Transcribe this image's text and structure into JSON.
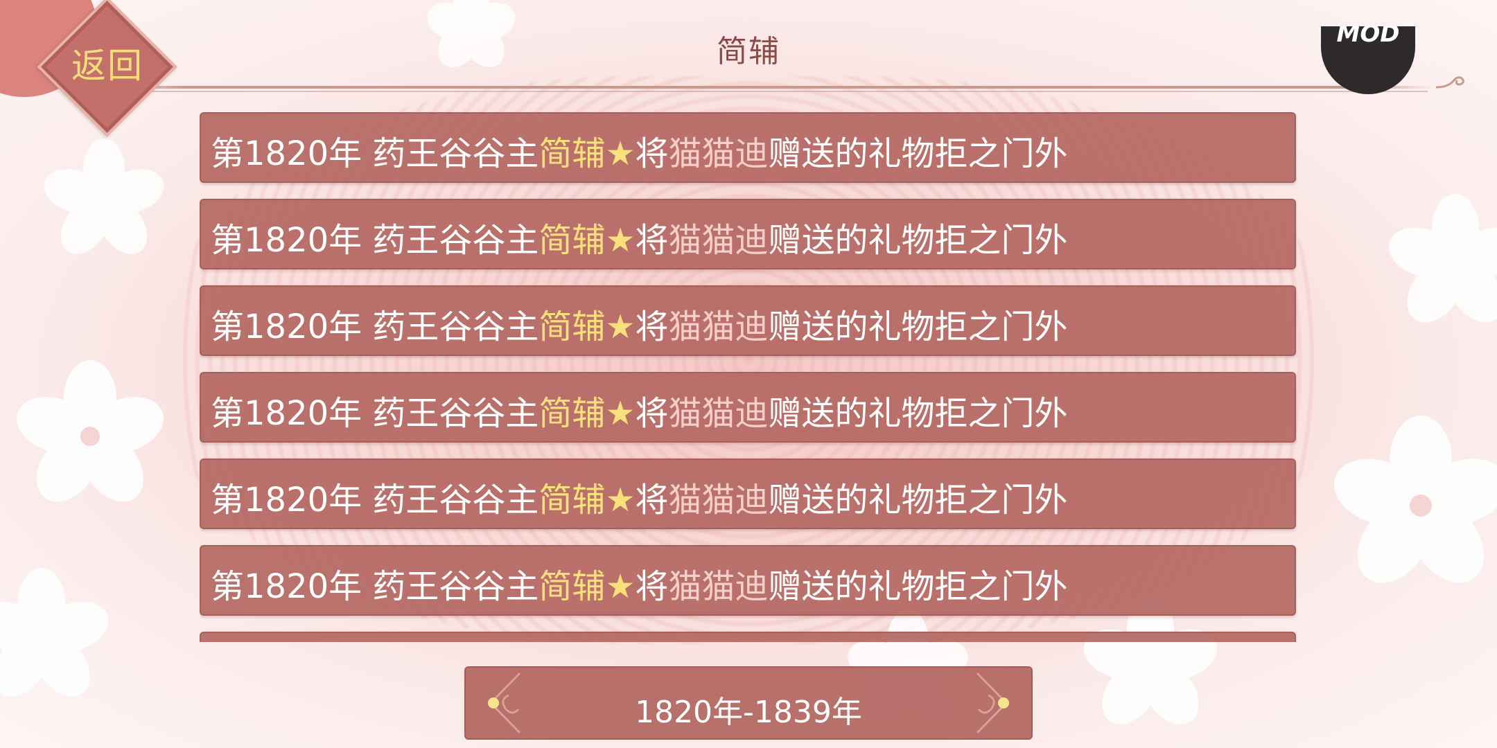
{
  "header": {
    "title": "简辅",
    "back_label": "返回",
    "badge_label": "MOD"
  },
  "entries": [
    {
      "prefix": "第1820年 药王谷谷主",
      "name": "简辅",
      "star": "★",
      "verb": "将",
      "target": "猫猫迪",
      "rest": "赠送的礼物拒之门外"
    },
    {
      "prefix": "第1820年 药王谷谷主",
      "name": "简辅",
      "star": "★",
      "verb": "将",
      "target": "猫猫迪",
      "rest": "赠送的礼物拒之门外"
    },
    {
      "prefix": "第1820年 药王谷谷主",
      "name": "简辅",
      "star": "★",
      "verb": "将",
      "target": "猫猫迪",
      "rest": "赠送的礼物拒之门外"
    },
    {
      "prefix": "第1820年 药王谷谷主",
      "name": "简辅",
      "star": "★",
      "verb": "将",
      "target": "猫猫迪",
      "rest": "赠送的礼物拒之门外"
    },
    {
      "prefix": "第1820年 药王谷谷主",
      "name": "简辅",
      "star": "★",
      "verb": "将",
      "target": "猫猫迪",
      "rest": "赠送的礼物拒之门外"
    },
    {
      "prefix": "第1820年 药王谷谷主",
      "name": "简辅",
      "star": "★",
      "verb": "将",
      "target": "猫猫迪",
      "rest": "赠送的礼物拒之门外"
    },
    {
      "prefix": "",
      "name": "",
      "star": "",
      "verb": "",
      "target": "",
      "rest": ""
    }
  ],
  "pager": {
    "range_label": "1820年-1839年"
  },
  "colors": {
    "item_bg": "#b2655f",
    "name_highlight": "#f9e07c",
    "back_button": "#c3706a",
    "back_text": "#f7dc7c"
  }
}
